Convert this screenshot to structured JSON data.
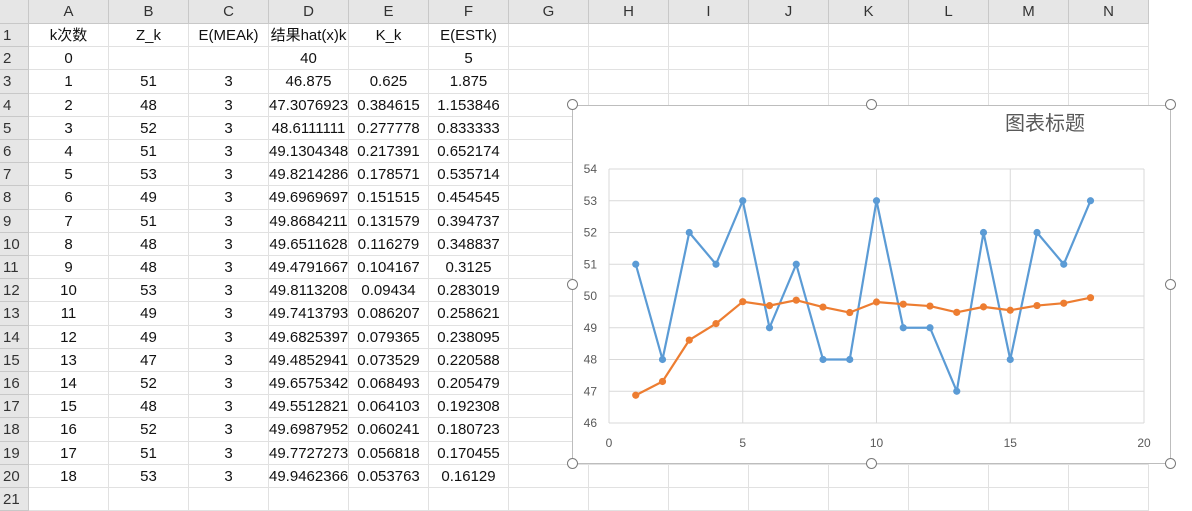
{
  "sheet": {
    "columns": [
      "A",
      "B",
      "C",
      "D",
      "E",
      "F",
      "G",
      "H",
      "I",
      "J",
      "K",
      "L",
      "M",
      "N"
    ],
    "row_numbers": [
      "1",
      "2",
      "3",
      "4",
      "5",
      "6",
      "7",
      "8",
      "9",
      "10",
      "11",
      "12",
      "13",
      "14",
      "15",
      "16",
      "17",
      "18",
      "19",
      "20",
      "21"
    ],
    "rows": [
      [
        "k次数",
        "Z_k",
        "E(MEAk)",
        "结果hat(x)k",
        "K_k",
        "E(ESTk)"
      ],
      [
        "0",
        "",
        "",
        "40",
        "",
        "5"
      ],
      [
        "1",
        "51",
        "3",
        "46.875",
        "0.625",
        "1.875"
      ],
      [
        "2",
        "48",
        "3",
        "47.3076923",
        "0.384615",
        "1.153846"
      ],
      [
        "3",
        "52",
        "3",
        "48.6111111",
        "0.277778",
        "0.833333"
      ],
      [
        "4",
        "51",
        "3",
        "49.1304348",
        "0.217391",
        "0.652174"
      ],
      [
        "5",
        "53",
        "3",
        "49.8214286",
        "0.178571",
        "0.535714"
      ],
      [
        "6",
        "49",
        "3",
        "49.6969697",
        "0.151515",
        "0.454545"
      ],
      [
        "7",
        "51",
        "3",
        "49.8684211",
        "0.131579",
        "0.394737"
      ],
      [
        "8",
        "48",
        "3",
        "49.6511628",
        "0.116279",
        "0.348837"
      ],
      [
        "9",
        "48",
        "3",
        "49.4791667",
        "0.104167",
        "0.3125"
      ],
      [
        "10",
        "53",
        "3",
        "49.8113208",
        "0.09434",
        "0.283019"
      ],
      [
        "11",
        "49",
        "3",
        "49.7413793",
        "0.086207",
        "0.258621"
      ],
      [
        "12",
        "49",
        "3",
        "49.6825397",
        "0.079365",
        "0.238095"
      ],
      [
        "13",
        "47",
        "3",
        "49.4852941",
        "0.073529",
        "0.220588"
      ],
      [
        "14",
        "52",
        "3",
        "49.6575342",
        "0.068493",
        "0.205479"
      ],
      [
        "15",
        "48",
        "3",
        "49.5512821",
        "0.064103",
        "0.192308"
      ],
      [
        "16",
        "52",
        "3",
        "49.6987952",
        "0.060241",
        "0.180723"
      ],
      [
        "17",
        "51",
        "3",
        "49.7727273",
        "0.056818",
        "0.170455"
      ],
      [
        "18",
        "53",
        "3",
        "49.9462366",
        "0.053763",
        "0.16129"
      ],
      [
        "",
        "",
        "",
        "",
        "",
        ""
      ]
    ]
  },
  "chart_data": {
    "type": "line",
    "title": "图表标题",
    "xlim": [
      0,
      20
    ],
    "ylim": [
      46,
      54
    ],
    "xticks": [
      "0",
      "5",
      "10",
      "15",
      "20"
    ],
    "yticks": [
      "46",
      "47",
      "48",
      "49",
      "50",
      "51",
      "52",
      "53",
      "54"
    ],
    "grid": true,
    "legend": "none",
    "x": [
      1,
      2,
      3,
      4,
      5,
      6,
      7,
      8,
      9,
      10,
      11,
      12,
      13,
      14,
      15,
      16,
      17,
      18
    ],
    "series": [
      {
        "color": "#5b9bd5",
        "values": [
          51,
          48,
          52,
          51,
          53,
          49,
          51,
          48,
          48,
          53,
          49,
          49,
          47,
          52,
          48,
          52,
          51,
          53
        ]
      },
      {
        "color": "#ed7d31",
        "values": [
          46.875,
          47.3076923,
          48.6111111,
          49.1304348,
          49.8214286,
          49.6969697,
          49.8684211,
          49.6511628,
          49.4791667,
          49.8113208,
          49.7413793,
          49.6825397,
          49.4852941,
          49.6575342,
          49.5512821,
          49.6987952,
          49.7727273,
          49.9462366
        ]
      }
    ]
  }
}
